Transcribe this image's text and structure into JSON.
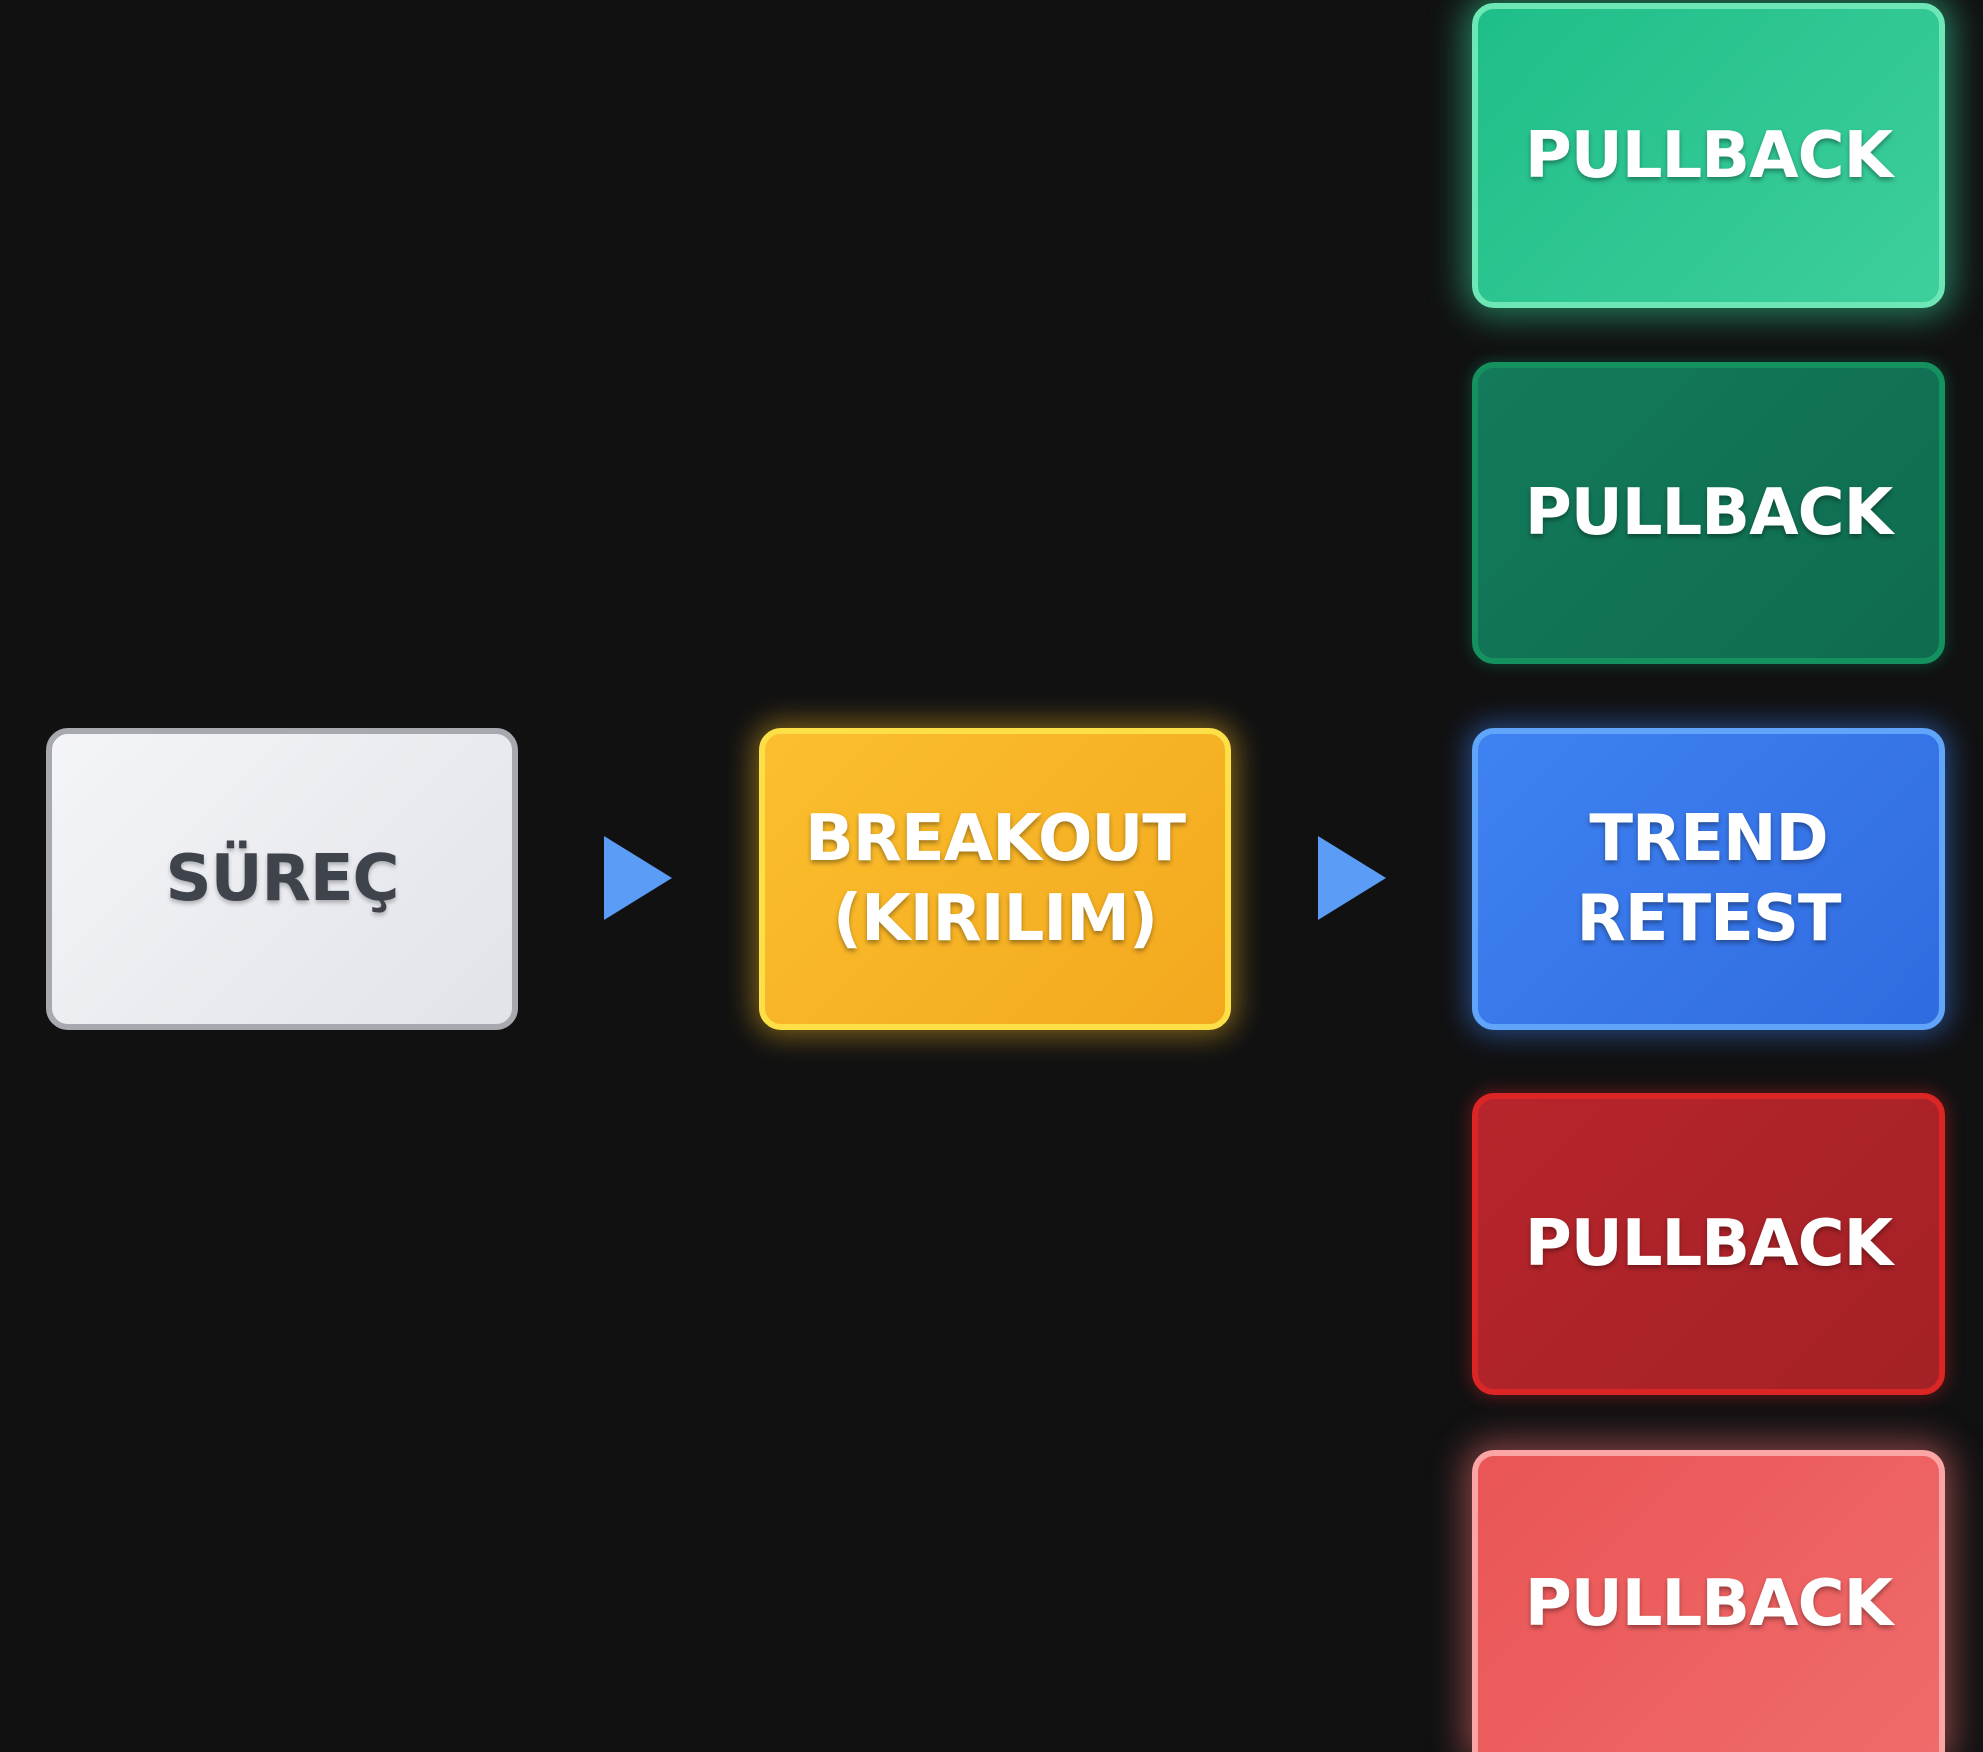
{
  "diagram": {
    "nodes": {
      "process": {
        "label": "SÜREÇ"
      },
      "breakout": {
        "line1": "BREAKOUT",
        "line2": "(KIRILIM)"
      },
      "pullback_1": {
        "label": "PULLBACK"
      },
      "pullback_2": {
        "label": "PULLBACK"
      },
      "trend_retest": {
        "line1": "TREND",
        "line2": "RETEST"
      },
      "pullback_4": {
        "label": "PULLBACK"
      },
      "pullback_5": {
        "label": "PULLBACK"
      }
    },
    "colors": {
      "background": "#111112",
      "process": "#e9eaee",
      "breakout": "#f8b427",
      "pullback_light_green": "#34c994",
      "pullback_dark_green": "#117354",
      "trend_retest": "#3676e8",
      "pullback_dark_red": "#ad2329",
      "pullback_light_red": "#ed6060",
      "arrow": "#5b9cf6"
    },
    "arrow_icon": "triangle-right-icon"
  }
}
